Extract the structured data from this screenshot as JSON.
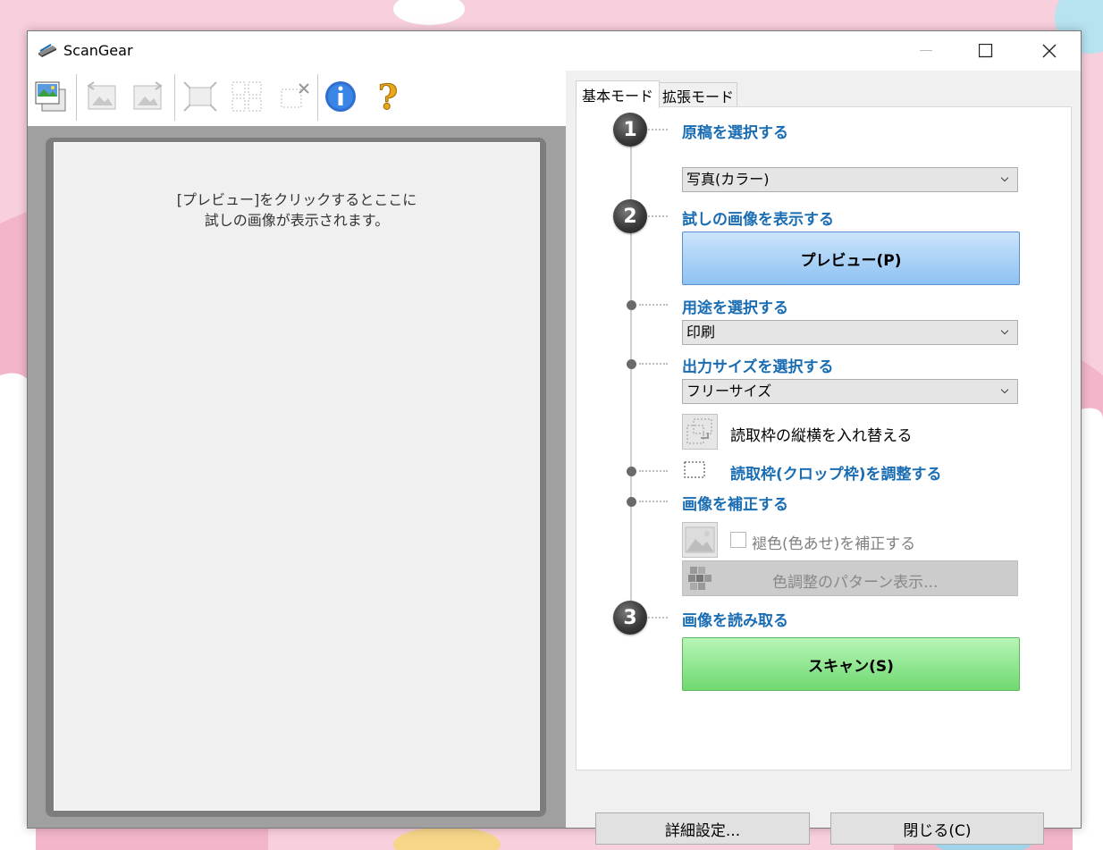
{
  "window": {
    "title": "ScanGear"
  },
  "preview": {
    "message_line1": "[プレビュー]をクリックするとここに",
    "message_line2": "試しの画像が表示されます。"
  },
  "tabs": [
    {
      "label": "基本モード",
      "active": true
    },
    {
      "label": "拡張モード",
      "active": false
    }
  ],
  "steps": {
    "step1": {
      "number": "1",
      "label": "原稿を選択する",
      "select_value": "写真(カラー)"
    },
    "step2": {
      "number": "2",
      "label": "試しの画像を表示する",
      "button_label": "プレビュー(P)"
    },
    "purpose": {
      "label": "用途を選択する",
      "select_value": "印刷"
    },
    "output_size": {
      "label": "出力サイズを選択する",
      "select_value": "フリーサイズ"
    },
    "swap_frame_label": "読取枠の縦横を入れ替える",
    "crop_frame_label": "読取枠(クロップ枠)を調整する",
    "correction": {
      "label": "画像を補正する",
      "fade_correction_label": "褪色(色あせ)を補正する",
      "color_pattern_label": "色調整のパターン表示..."
    },
    "step3": {
      "number": "3",
      "label": "画像を読み取る",
      "button_label": "スキャン(S)"
    }
  },
  "bottom": {
    "advanced_label": "詳細設定...",
    "close_label": "閉じる(C)"
  },
  "colors": {
    "section_label": "#1a6db3",
    "preview_button": "#8ec2f3",
    "scan_button": "#6fd96f"
  }
}
